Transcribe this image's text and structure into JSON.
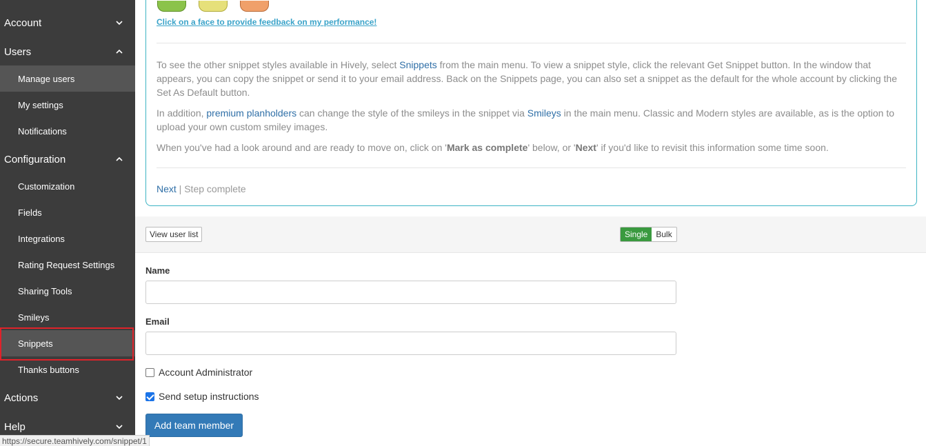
{
  "sidebar": {
    "sections": [
      {
        "label": "Account",
        "state": "collapsed"
      },
      {
        "label": "Users",
        "state": "expanded"
      },
      {
        "label": "Configuration",
        "state": "expanded"
      },
      {
        "label": "Actions",
        "state": "collapsed"
      },
      {
        "label": "Help",
        "state": "collapsed"
      }
    ],
    "users_items": [
      {
        "label": "Manage users",
        "active": true
      },
      {
        "label": "My settings"
      },
      {
        "label": "Notifications"
      }
    ],
    "config_items": [
      {
        "label": "Customization"
      },
      {
        "label": "Fields"
      },
      {
        "label": "Integrations"
      },
      {
        "label": "Rating Request Settings"
      },
      {
        "label": "Sharing Tools"
      },
      {
        "label": "Smileys"
      },
      {
        "label": "Snippets",
        "highlighted": true
      },
      {
        "label": "Thanks buttons"
      }
    ]
  },
  "tutorial": {
    "face_link": "Click on a face to provide feedback on my performance!",
    "p1_a": "To see the other snippet styles available in Hively, select ",
    "p1_link": "Snippets",
    "p1_b": " from the main menu. To view a snippet style, click the relevant Get Snippet button. In the window that appears, you can copy the snippet or send it to your email address. Back on the Snippets page, you can also set a snippet as the default for the whole account by clicking the Set As Default button.",
    "p2_a": "In addition, ",
    "p2_link1": "premium planholders",
    "p2_b": " can change the style of the smileys in the snippet via ",
    "p2_link2": "Smileys",
    "p2_c": " in the main menu. Classic and Modern styles are available, as is the option to upload your own custom smiley images.",
    "p3_a": "When you've had a look around and are ready to move on, click on '",
    "p3_b1": "Mark as complete",
    "p3_c": "' below, or '",
    "p3_b2": "Next",
    "p3_d": "' if you'd like to revisit this information some time soon.",
    "next": "Next",
    "sep": " | ",
    "complete": "Step complete"
  },
  "toolbar": {
    "view_list": "View user list",
    "single": "Single",
    "bulk": "Bulk"
  },
  "form": {
    "name_label": "Name",
    "name_value": "",
    "email_label": "Email",
    "email_value": "",
    "admin_label": "Account Administrator",
    "admin_checked": false,
    "setup_label": "Send setup instructions",
    "setup_checked": true,
    "submit": "Add team member"
  },
  "status_url": "https://secure.teamhively.com/snippet/1"
}
